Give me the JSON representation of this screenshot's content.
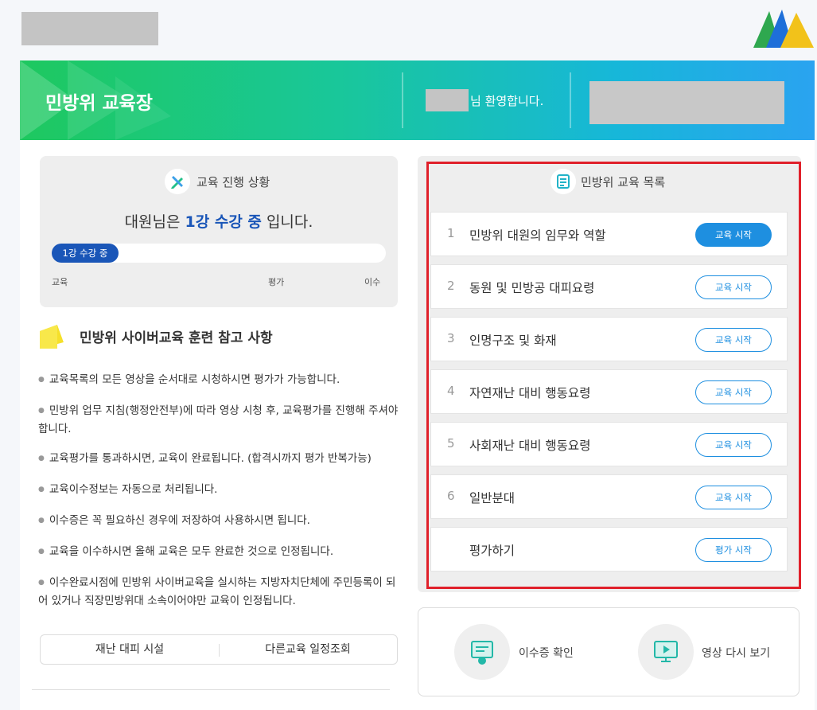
{
  "banner": {
    "title": "민방위 교육장",
    "welcome": "님 환영합니다."
  },
  "progress": {
    "title": "교육 진행 상황",
    "status_prefix": "대원님은 ",
    "status_highlight": "1강 수강 중",
    "status_suffix": " 입니다.",
    "bar_label": "1강 수강 중",
    "fill_fraction": 0.2,
    "steps": [
      "교육",
      "평가",
      "이수"
    ]
  },
  "notice": {
    "title": "민방위 사이버교육 훈련 참고 사항",
    "items": [
      "교육목록의 모든 영상을 순서대로 시청하시면 평가가 가능합니다.",
      "민방위 업무 지침(행정안전부)에 따라 영상 시청 후, 교육평가를 진행해 주셔야 합니다.",
      "교육평가를 통과하시면, 교육이 완료됩니다. (합격시까지 평가 반복가능)",
      "교육이수정보는 자동으로 처리됩니다.",
      "이수증은 꼭 필요하신 경우에 저장하여 사용하시면 됩니다.",
      "교육을 이수하시면 올해 교육은 모두 완료한 것으로 인정됩니다.",
      "이수완료시점에 민방위 사이버교육을 실시하는 지방자치단체에 주민등록이 되어 있거나 직장민방위대 소속이어야만 교육이 인정됩니다."
    ]
  },
  "bottom_tabs": [
    "재난 대피 시설",
    "다른교육 일정조회"
  ],
  "courses": {
    "title": "민방위 교육 목록",
    "items": [
      {
        "num": "1",
        "name": "민방위 대원의 임무와 역할",
        "button": "교육 시작",
        "active": true
      },
      {
        "num": "2",
        "name": "동원 및 민방공 대피요령",
        "button": "교육 시작",
        "active": false
      },
      {
        "num": "3",
        "name": "인명구조 및 화재",
        "button": "교육 시작",
        "active": false
      },
      {
        "num": "4",
        "name": "자연재난 대비 행동요령",
        "button": "교육 시작",
        "active": false
      },
      {
        "num": "5",
        "name": "사회재난 대비 행동요령",
        "button": "교육 시작",
        "active": false
      },
      {
        "num": "6",
        "name": "일반분대",
        "button": "교육 시작",
        "active": false
      },
      {
        "num": "",
        "name": "평가하기",
        "button": "평가 시작",
        "active": false
      }
    ]
  },
  "actions": {
    "certificate": "이수증 확인",
    "replay": "영상 다시 보기"
  },
  "colors": {
    "accent": "#1e8fe0",
    "progress": "#1a56b8",
    "highlight_border": "#e0202a",
    "banner_start": "#1ec85f",
    "banner_end": "#2aa3f0"
  }
}
